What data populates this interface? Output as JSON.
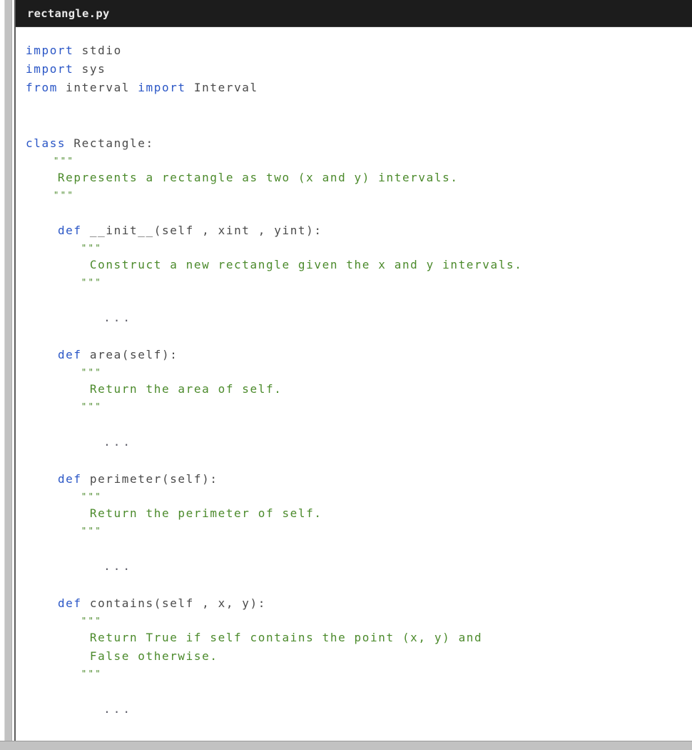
{
  "window": {
    "file_name": "rectangle.py",
    "colors": {
      "titlebar_bg": "#1c1c1c",
      "titlebar_text": "#e8e8e8",
      "panel_bg": "#ffffff",
      "scrollbar": "#c2c2c2",
      "keyword": "#2a56c6",
      "string": "#4b8a2b",
      "identifier": "#4a4a4a"
    }
  },
  "code": {
    "lines": [
      {
        "type": "code",
        "kw": "import",
        "rest": " stdio"
      },
      {
        "type": "code",
        "kw": "import",
        "rest": " sys"
      },
      {
        "type": "mixed",
        "kw": "from",
        "mid": " interval ",
        "kw2": "import",
        "rest": " Interval"
      },
      {
        "type": "blank",
        "text": ""
      },
      {
        "type": "blank",
        "text": ""
      },
      {
        "type": "code",
        "kw": "class",
        "rest": " Rectangle:"
      },
      {
        "type": "quote",
        "indent": 4,
        "text": "\"\"\""
      },
      {
        "type": "str",
        "indent": 4,
        "text": "Represents a rectangle as two (x and y) intervals."
      },
      {
        "type": "quote",
        "indent": 4,
        "text": "\"\"\""
      },
      {
        "type": "blank",
        "text": ""
      },
      {
        "type": "code",
        "indent": 4,
        "kw": "def",
        "rest": " __init__(self , xint , yint):"
      },
      {
        "type": "quote",
        "indent": 8,
        "text": "\"\"\""
      },
      {
        "type": "str",
        "indent": 8,
        "text": "Construct a new rectangle given the x and y intervals."
      },
      {
        "type": "quote",
        "indent": 8,
        "text": "\"\"\""
      },
      {
        "type": "blank",
        "text": ""
      },
      {
        "type": "dots",
        "indent": 8,
        "text": "..."
      },
      {
        "type": "blank",
        "text": ""
      },
      {
        "type": "code",
        "indent": 4,
        "kw": "def",
        "rest": " area(self):"
      },
      {
        "type": "quote",
        "indent": 8,
        "text": "\"\"\""
      },
      {
        "type": "str",
        "indent": 8,
        "text": "Return the area of self."
      },
      {
        "type": "quote",
        "indent": 8,
        "text": "\"\"\""
      },
      {
        "type": "blank",
        "text": ""
      },
      {
        "type": "dots",
        "indent": 8,
        "text": "..."
      },
      {
        "type": "blank",
        "text": ""
      },
      {
        "type": "code",
        "indent": 4,
        "kw": "def",
        "rest": " perimeter(self):"
      },
      {
        "type": "quote",
        "indent": 8,
        "text": "\"\"\""
      },
      {
        "type": "str",
        "indent": 8,
        "text": "Return the perimeter of self."
      },
      {
        "type": "quote",
        "indent": 8,
        "text": "\"\"\""
      },
      {
        "type": "blank",
        "text": ""
      },
      {
        "type": "dots",
        "indent": 8,
        "text": "..."
      },
      {
        "type": "blank",
        "text": ""
      },
      {
        "type": "code",
        "indent": 4,
        "kw": "def",
        "rest": " contains(self , x, y):"
      },
      {
        "type": "quote",
        "indent": 8,
        "text": "\"\"\""
      },
      {
        "type": "str",
        "indent": 8,
        "text": "Return True if self contains the point (x, y) and"
      },
      {
        "type": "str",
        "indent": 8,
        "text": "False otherwise."
      },
      {
        "type": "quote",
        "indent": 8,
        "text": "\"\"\""
      },
      {
        "type": "blank",
        "text": ""
      },
      {
        "type": "dots",
        "indent": 8,
        "text": "..."
      }
    ]
  }
}
